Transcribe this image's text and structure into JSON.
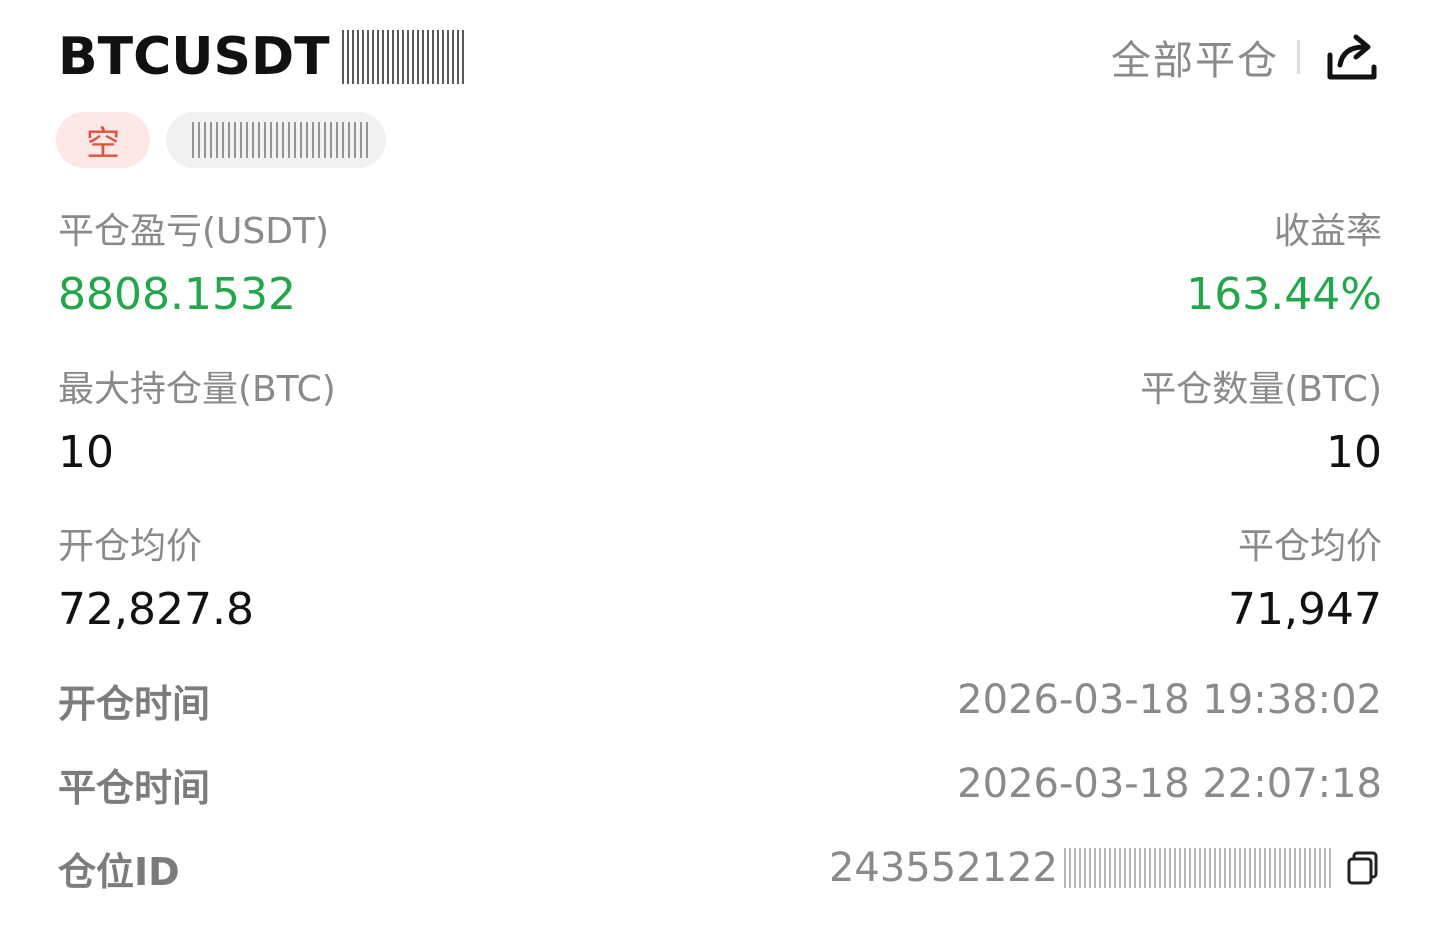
{
  "header": {
    "pair": "BTCUSDT",
    "close_all_label": "全部平仓",
    "share_icon": "share-icon"
  },
  "tags": {
    "direction": "空"
  },
  "stats": {
    "pnl_label": "平仓盈亏(USDT)",
    "pnl_value": "8808.1532",
    "roi_label": "收益率",
    "roi_value": "163.44%",
    "max_position_label": "最大持仓量(BTC)",
    "max_position_value": "10",
    "closed_qty_label": "平仓数量(BTC)",
    "closed_qty_value": "10",
    "open_avg_label": "开仓均价",
    "open_avg_value": "72,827.8",
    "close_avg_label": "平仓均价",
    "close_avg_value": "71,947"
  },
  "info": {
    "open_time_label": "开仓时间",
    "open_time_value": "2026-03-18 19:38:02",
    "close_time_label": "平仓时间",
    "close_time_value": "2026-03-18 22:07:18",
    "position_id_label": "仓位ID",
    "position_id_value": "243552122"
  },
  "colors": {
    "profit_green": "#22a84a",
    "short_red": "#e0503e",
    "short_bg": "#fde8e6",
    "label_gray": "#8a8a8a"
  }
}
